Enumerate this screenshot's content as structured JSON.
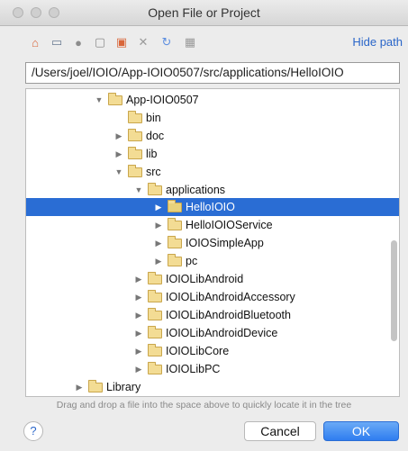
{
  "window": {
    "title": "Open File or Project"
  },
  "toolbar": {
    "icons": [
      "home-icon",
      "desktop-icon",
      "project-icon",
      "folder-icon",
      "new-folder-icon",
      "delete-icon",
      "refresh-icon",
      "show-hidden-icon"
    ],
    "hide_path_label": "Hide path"
  },
  "path": {
    "value": "/Users/joel/IOIO/App-IOIO0507/src/applications/HelloIOIO"
  },
  "tree": {
    "items": [
      {
        "label": "App-IOIO0507",
        "expanded": true
      },
      {
        "label": "bin",
        "expanded": false
      },
      {
        "label": "doc",
        "expanded": false
      },
      {
        "label": "lib",
        "expanded": false
      },
      {
        "label": "src",
        "expanded": true
      },
      {
        "label": "applications",
        "expanded": true
      },
      {
        "label": "HelloIOIO",
        "expanded": false,
        "selected": true
      },
      {
        "label": "HelloIOIOService",
        "expanded": false
      },
      {
        "label": "IOIOSimpleApp",
        "expanded": false
      },
      {
        "label": "pc",
        "expanded": false
      },
      {
        "label": "IOIOLibAndroid",
        "expanded": false
      },
      {
        "label": "IOIOLibAndroidAccessory",
        "expanded": false
      },
      {
        "label": "IOIOLibAndroidBluetooth",
        "expanded": false
      },
      {
        "label": "IOIOLibAndroidDevice",
        "expanded": false
      },
      {
        "label": "IOIOLibCore",
        "expanded": false
      },
      {
        "label": "IOIOLibPC",
        "expanded": false
      },
      {
        "label": "Library",
        "expanded": false
      }
    ]
  },
  "hint": "Drag and drop a file into the space above to quickly locate it in the tree",
  "buttons": {
    "help": "?",
    "cancel": "Cancel",
    "ok": "OK"
  },
  "colors": {
    "selection": "#2a6dd4",
    "link": "#2a66c9",
    "primary_button": "#2f7df0"
  }
}
